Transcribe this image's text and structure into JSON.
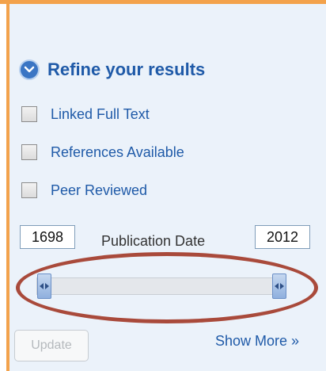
{
  "refine": {
    "title": "Refine your results",
    "icon": "chevron-down-circle-icon"
  },
  "facets": [
    {
      "label": "Linked Full Text",
      "checked": false
    },
    {
      "label": "References Available",
      "checked": false
    },
    {
      "label": "Peer Reviewed",
      "checked": false
    }
  ],
  "date_filter": {
    "label": "Publication Date",
    "start_year": "1698",
    "end_year": "2012",
    "range_start_fraction": 0,
    "range_end_fraction": 1
  },
  "actions": {
    "update_label": "Update",
    "show_more_label": "Show More »"
  },
  "colors": {
    "accent_border": "#f3a24b",
    "link_blue": "#1f5aa8",
    "panel_bg": "#ebf2fa",
    "annotation_oval": "#a94a3b"
  }
}
